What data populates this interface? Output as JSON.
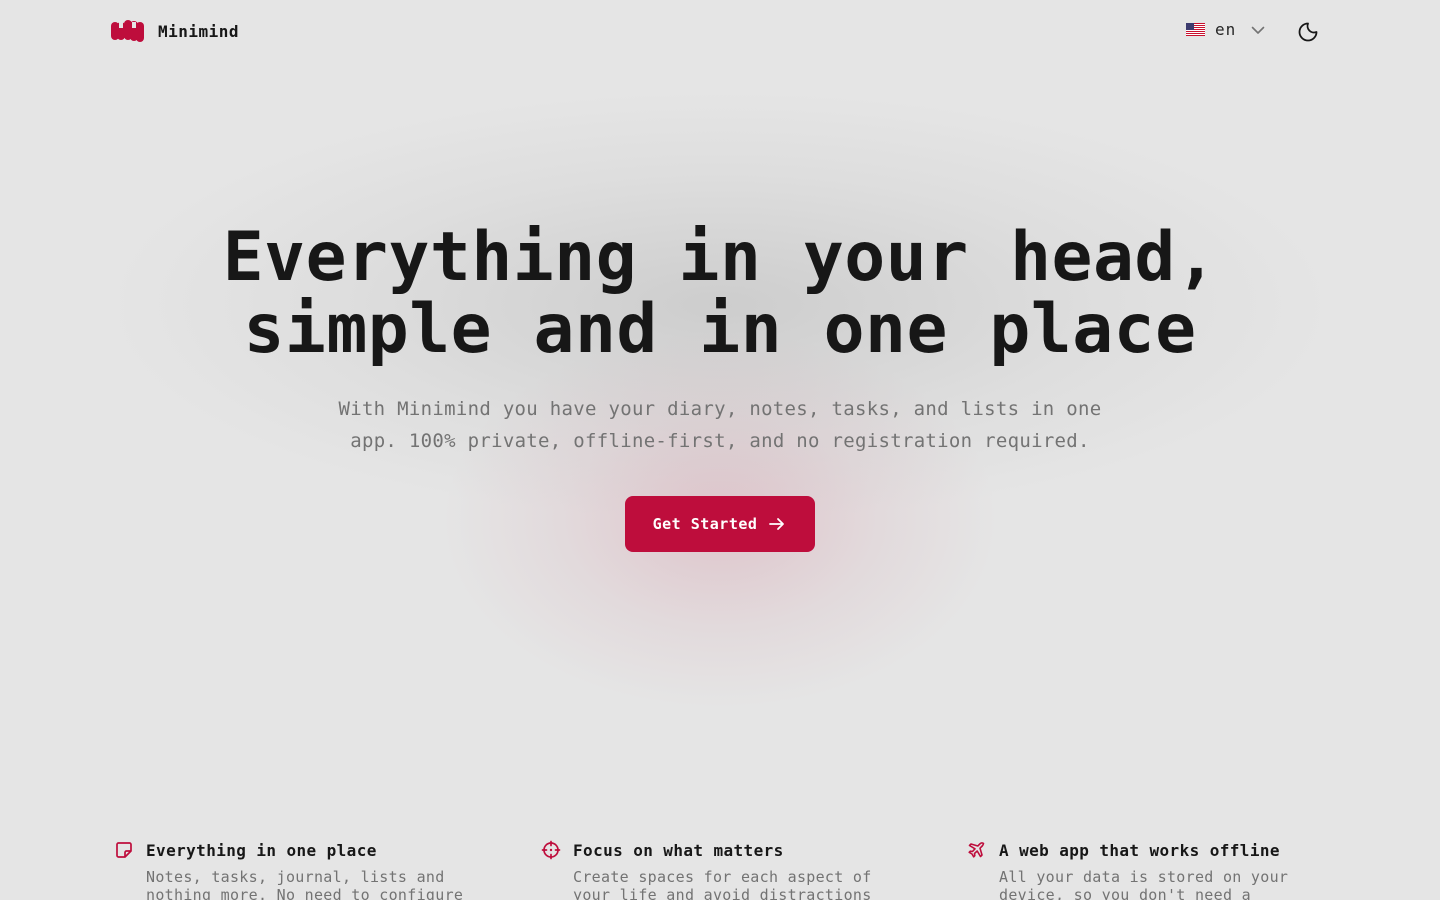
{
  "header": {
    "brand_name": "Minimind",
    "language": {
      "flag_icon": "us-flag-icon",
      "code": "en"
    },
    "theme_toggle_icon": "moon-icon"
  },
  "hero": {
    "title_lines": [
      "Everything in your head,",
      "simple and in one place"
    ],
    "subtitle_lines": [
      "With Minimind you have your diary, notes, tasks, and lists in one",
      "app. 100% private, offline-first, and no registration required."
    ],
    "cta_label": "Get Started",
    "cta_icon": "arrow-right-icon"
  },
  "features": [
    {
      "icon": "sticky-note-icon",
      "title": "Everything in one place",
      "desc_lines": [
        "Notes, tasks, journal, lists and",
        "nothing more. No need to configure"
      ]
    },
    {
      "icon": "crosshair-icon",
      "title": "Focus on what matters",
      "desc_lines": [
        "Create spaces for each aspect of",
        "your life and avoid distractions"
      ]
    },
    {
      "icon": "plane-icon",
      "title": "A web app that works offline",
      "desc_lines": [
        "All your data is stored on your",
        "device, so you don't need a"
      ]
    }
  ],
  "colors": {
    "background": "#e5e5e5",
    "accent": "#be0d3c",
    "text": "#171717",
    "muted": "#737373"
  }
}
